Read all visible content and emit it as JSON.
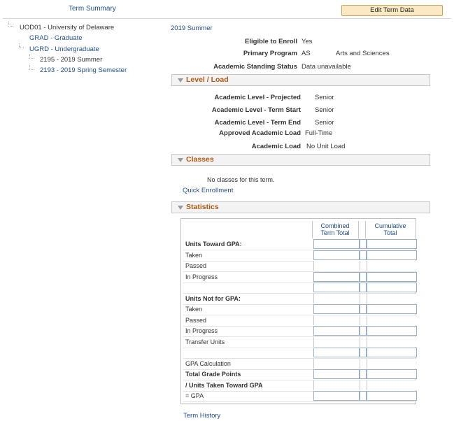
{
  "header": {
    "term_summary": "Term Summary",
    "edit_term_button": "Edit Term Data"
  },
  "tree": {
    "root": "UOD01 - University of Delaware",
    "items": [
      {
        "label": "GRAD - Graduate"
      },
      {
        "label": "UGRD - Undergraduate"
      },
      {
        "label": "2195 - 2019 Summer"
      },
      {
        "label": "2193 - 2019 Spring Semester"
      }
    ]
  },
  "term": {
    "title": "2019 Summer",
    "eligible_label": "Eligible to Enroll",
    "eligible_value": "Yes",
    "program_label": "Primary Program",
    "program_code": "AS",
    "program_name": "Arts and Sciences",
    "standing_label": "Academic Standing Status",
    "standing_value": "Data unavailable"
  },
  "level_load": {
    "title": "Level / Load",
    "rows": [
      {
        "label": "Academic Level - Projected",
        "value": "Senior"
      },
      {
        "label": "Academic Level - Term Start",
        "value": "Senior"
      },
      {
        "label": "Academic Level - Term End",
        "value": "Senior"
      },
      {
        "label": "Approved Academic Load",
        "value": "Full-Time"
      },
      {
        "label": "Academic Load",
        "value": "No Unit Load"
      }
    ]
  },
  "classes": {
    "title": "Classes",
    "empty_message": "No classes for this term.",
    "quick_enrollment": "Quick Enrollment"
  },
  "statistics": {
    "title": "Statistics",
    "col_combined_1": "Combined",
    "col_combined_2": "Term Total",
    "col_cumulative_1": "Cumulative",
    "col_cumulative_2": "Total",
    "rows": [
      {
        "label": "Units Toward GPA:",
        "bold": true
      },
      {
        "label": "Taken"
      },
      {
        "label": "Passed"
      },
      {
        "label": "In Progress"
      },
      {
        "label": ""
      },
      {
        "label": "Units Not for GPA:",
        "bold": true
      },
      {
        "label": "Taken"
      },
      {
        "label": "Passed"
      },
      {
        "label": "In Progress"
      },
      {
        "label": "Transfer Units"
      },
      {
        "label": ""
      },
      {
        "label": "GPA Calculation"
      },
      {
        "label": "Total Grade Points",
        "bold": true
      },
      {
        "label": "/  Units Taken Toward GPA",
        "bold": true
      },
      {
        "label": "= GPA"
      }
    ]
  },
  "footer": {
    "term_history": "Term History"
  }
}
